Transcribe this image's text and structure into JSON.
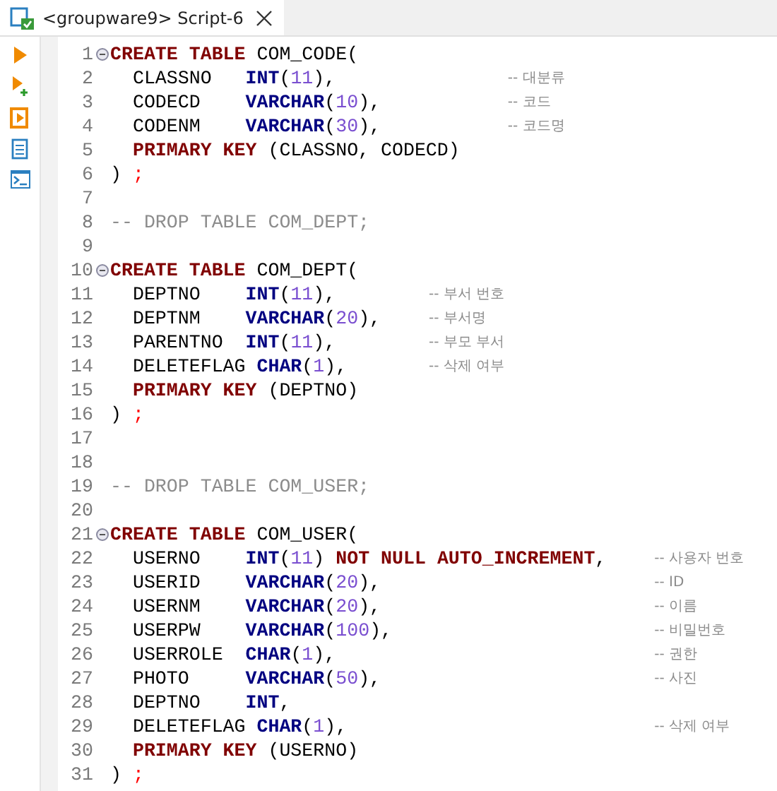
{
  "tab": {
    "title": "<groupware9> Script-6",
    "selected": true
  },
  "blocks": [
    {
      "lines": [
        {
          "num": "1",
          "fold": true,
          "tokens": [
            {
              "kind": "keyword",
              "text": "CREATE TABLE"
            },
            {
              "kind": "identifier",
              "text": " COM_CODE("
            }
          ]
        },
        {
          "num": "2",
          "fold": false,
          "tokens": [
            {
              "kind": "identifier",
              "text": "  CLASSNO   "
            },
            {
              "kind": "type",
              "text": "INT"
            },
            {
              "kind": "identifier",
              "text": "("
            },
            {
              "kind": "number",
              "text": "11"
            },
            {
              "kind": "identifier",
              "text": "),"
            }
          ],
          "comment": "-- 대분류"
        },
        {
          "num": "3",
          "fold": false,
          "tokens": [
            {
              "kind": "identifier",
              "text": "  CODECD    "
            },
            {
              "kind": "type",
              "text": "VARCHAR"
            },
            {
              "kind": "identifier",
              "text": "("
            },
            {
              "kind": "number",
              "text": "10"
            },
            {
              "kind": "identifier",
              "text": "),"
            }
          ],
          "comment": "-- 코드"
        },
        {
          "num": "4",
          "fold": false,
          "tokens": [
            {
              "kind": "identifier",
              "text": "  CODENM    "
            },
            {
              "kind": "type",
              "text": "VARCHAR"
            },
            {
              "kind": "identifier",
              "text": "("
            },
            {
              "kind": "number",
              "text": "30"
            },
            {
              "kind": "identifier",
              "text": "),"
            }
          ],
          "comment": "-- 코드명"
        },
        {
          "num": "5",
          "fold": false,
          "tokens": [
            {
              "kind": "keyword",
              "text": "  PRIMARY KEY"
            },
            {
              "kind": "identifier",
              "text": " (CLASSNO, CODECD)"
            }
          ]
        },
        {
          "num": "6",
          "fold": false,
          "tokens": [
            {
              "kind": "identifier",
              "text": ") "
            },
            {
              "kind": "punct",
              "text": ";"
            }
          ]
        },
        {
          "num": "7",
          "fold": false
        },
        {
          "num": "8",
          "fold": false,
          "tokens": [
            {
              "kind": "comment",
              "text": "-- DROP TABLE COM_DEPT;"
            }
          ]
        },
        {
          "num": "9",
          "fold": false
        }
      ]
    },
    {
      "lines": [
        {
          "num": "10",
          "fold": true,
          "tokens": [
            {
              "kind": "keyword",
              "text": "CREATE TABLE"
            },
            {
              "kind": "identifier",
              "text": " COM_DEPT("
            }
          ]
        },
        {
          "num": "11",
          "fold": false,
          "tokens": [
            {
              "kind": "identifier",
              "text": "  DEPTNO    "
            },
            {
              "kind": "type",
              "text": "INT"
            },
            {
              "kind": "identifier",
              "text": "("
            },
            {
              "kind": "number",
              "text": "11"
            },
            {
              "kind": "identifier",
              "text": "),"
            }
          ],
          "comment": "-- 부서 번호"
        },
        {
          "num": "12",
          "fold": false,
          "tokens": [
            {
              "kind": "identifier",
              "text": "  DEPTNM    "
            },
            {
              "kind": "type",
              "text": "VARCHAR"
            },
            {
              "kind": "identifier",
              "text": "("
            },
            {
              "kind": "number",
              "text": "20"
            },
            {
              "kind": "identifier",
              "text": "),"
            }
          ],
          "comment": "-- 부서명"
        },
        {
          "num": "13",
          "fold": false,
          "tokens": [
            {
              "kind": "identifier",
              "text": "  PARENTNO  "
            },
            {
              "kind": "type",
              "text": "INT"
            },
            {
              "kind": "identifier",
              "text": "("
            },
            {
              "kind": "number",
              "text": "11"
            },
            {
              "kind": "identifier",
              "text": "),"
            }
          ],
          "comment": "-- 부모 부서"
        },
        {
          "num": "14",
          "fold": false,
          "tokens": [
            {
              "kind": "identifier",
              "text": "  DELETEFLAG "
            },
            {
              "kind": "type",
              "text": "CHAR"
            },
            {
              "kind": "identifier",
              "text": "("
            },
            {
              "kind": "number",
              "text": "1"
            },
            {
              "kind": "identifier",
              "text": "),"
            }
          ],
          "comment": "-- 삭제 여부"
        },
        {
          "num": "15",
          "fold": false,
          "tokens": [
            {
              "kind": "keyword",
              "text": "  PRIMARY KEY"
            },
            {
              "kind": "identifier",
              "text": " (DEPTNO)"
            }
          ]
        },
        {
          "num": "16",
          "fold": false,
          "tokens": [
            {
              "kind": "identifier",
              "text": ") "
            },
            {
              "kind": "punct",
              "text": ";"
            }
          ]
        },
        {
          "num": "17",
          "fold": false
        },
        {
          "num": "18",
          "fold": false
        },
        {
          "num": "19",
          "fold": false,
          "tokens": [
            {
              "kind": "comment",
              "text": "-- DROP TABLE COM_USER;"
            }
          ]
        },
        {
          "num": "20",
          "fold": false
        }
      ]
    },
    {
      "lines": [
        {
          "num": "21",
          "fold": true,
          "tokens": [
            {
              "kind": "keyword",
              "text": "CREATE TABLE"
            },
            {
              "kind": "identifier",
              "text": " COM_USER("
            }
          ]
        },
        {
          "num": "22",
          "fold": false,
          "tokens": [
            {
              "kind": "identifier",
              "text": "  USERNO    "
            },
            {
              "kind": "type",
              "text": "INT"
            },
            {
              "kind": "identifier",
              "text": "("
            },
            {
              "kind": "number",
              "text": "11"
            },
            {
              "kind": "identifier",
              "text": ") "
            },
            {
              "kind": "keyword",
              "text": "NOT NULL AUTO_INCREMENT"
            },
            {
              "kind": "identifier",
              "text": ","
            }
          ],
          "comment": "-- 사용자 번호"
        },
        {
          "num": "23",
          "fold": false,
          "tokens": [
            {
              "kind": "identifier",
              "text": "  USERID    "
            },
            {
              "kind": "type",
              "text": "VARCHAR"
            },
            {
              "kind": "identifier",
              "text": "("
            },
            {
              "kind": "number",
              "text": "20"
            },
            {
              "kind": "identifier",
              "text": "),"
            }
          ],
          "comment": "-- ID"
        },
        {
          "num": "24",
          "fold": false,
          "tokens": [
            {
              "kind": "identifier",
              "text": "  USERNM    "
            },
            {
              "kind": "type",
              "text": "VARCHAR"
            },
            {
              "kind": "identifier",
              "text": "("
            },
            {
              "kind": "number",
              "text": "20"
            },
            {
              "kind": "identifier",
              "text": "),"
            }
          ],
          "comment": "-- 이름"
        },
        {
          "num": "25",
          "fold": false,
          "tokens": [
            {
              "kind": "identifier",
              "text": "  USERPW    "
            },
            {
              "kind": "type",
              "text": "VARCHAR"
            },
            {
              "kind": "identifier",
              "text": "("
            },
            {
              "kind": "number",
              "text": "100"
            },
            {
              "kind": "identifier",
              "text": "),"
            }
          ],
          "comment": "-- 비밀번호"
        },
        {
          "num": "26",
          "fold": false,
          "tokens": [
            {
              "kind": "identifier",
              "text": "  USERROLE  "
            },
            {
              "kind": "type",
              "text": "CHAR"
            },
            {
              "kind": "identifier",
              "text": "("
            },
            {
              "kind": "number",
              "text": "1"
            },
            {
              "kind": "identifier",
              "text": "),"
            }
          ],
          "comment": "-- 권한"
        },
        {
          "num": "27",
          "fold": false,
          "tokens": [
            {
              "kind": "identifier",
              "text": "  PHOTO     "
            },
            {
              "kind": "type",
              "text": "VARCHAR"
            },
            {
              "kind": "identifier",
              "text": "("
            },
            {
              "kind": "number",
              "text": "50"
            },
            {
              "kind": "identifier",
              "text": "),"
            }
          ],
          "comment": "-- 사진"
        },
        {
          "num": "28",
          "fold": false,
          "tokens": [
            {
              "kind": "identifier",
              "text": "  DEPTNO    "
            },
            {
              "kind": "type",
              "text": "INT"
            },
            {
              "kind": "identifier",
              "text": ","
            }
          ]
        },
        {
          "num": "29",
          "fold": false,
          "tokens": [
            {
              "kind": "identifier",
              "text": "  DELETEFLAG "
            },
            {
              "kind": "type",
              "text": "CHAR"
            },
            {
              "kind": "identifier",
              "text": "("
            },
            {
              "kind": "number",
              "text": "1"
            },
            {
              "kind": "identifier",
              "text": "),"
            }
          ],
          "comment": "-- 삭제 여부"
        },
        {
          "num": "30",
          "fold": false,
          "tokens": [
            {
              "kind": "keyword",
              "text": "  PRIMARY KEY"
            },
            {
              "kind": "identifier",
              "text": " (USERNO)"
            }
          ]
        },
        {
          "num": "31",
          "fold": false,
          "tokens": [
            {
              "kind": "identifier",
              "text": ") "
            },
            {
              "kind": "punct",
              "text": ";"
            }
          ]
        }
      ]
    }
  ]
}
